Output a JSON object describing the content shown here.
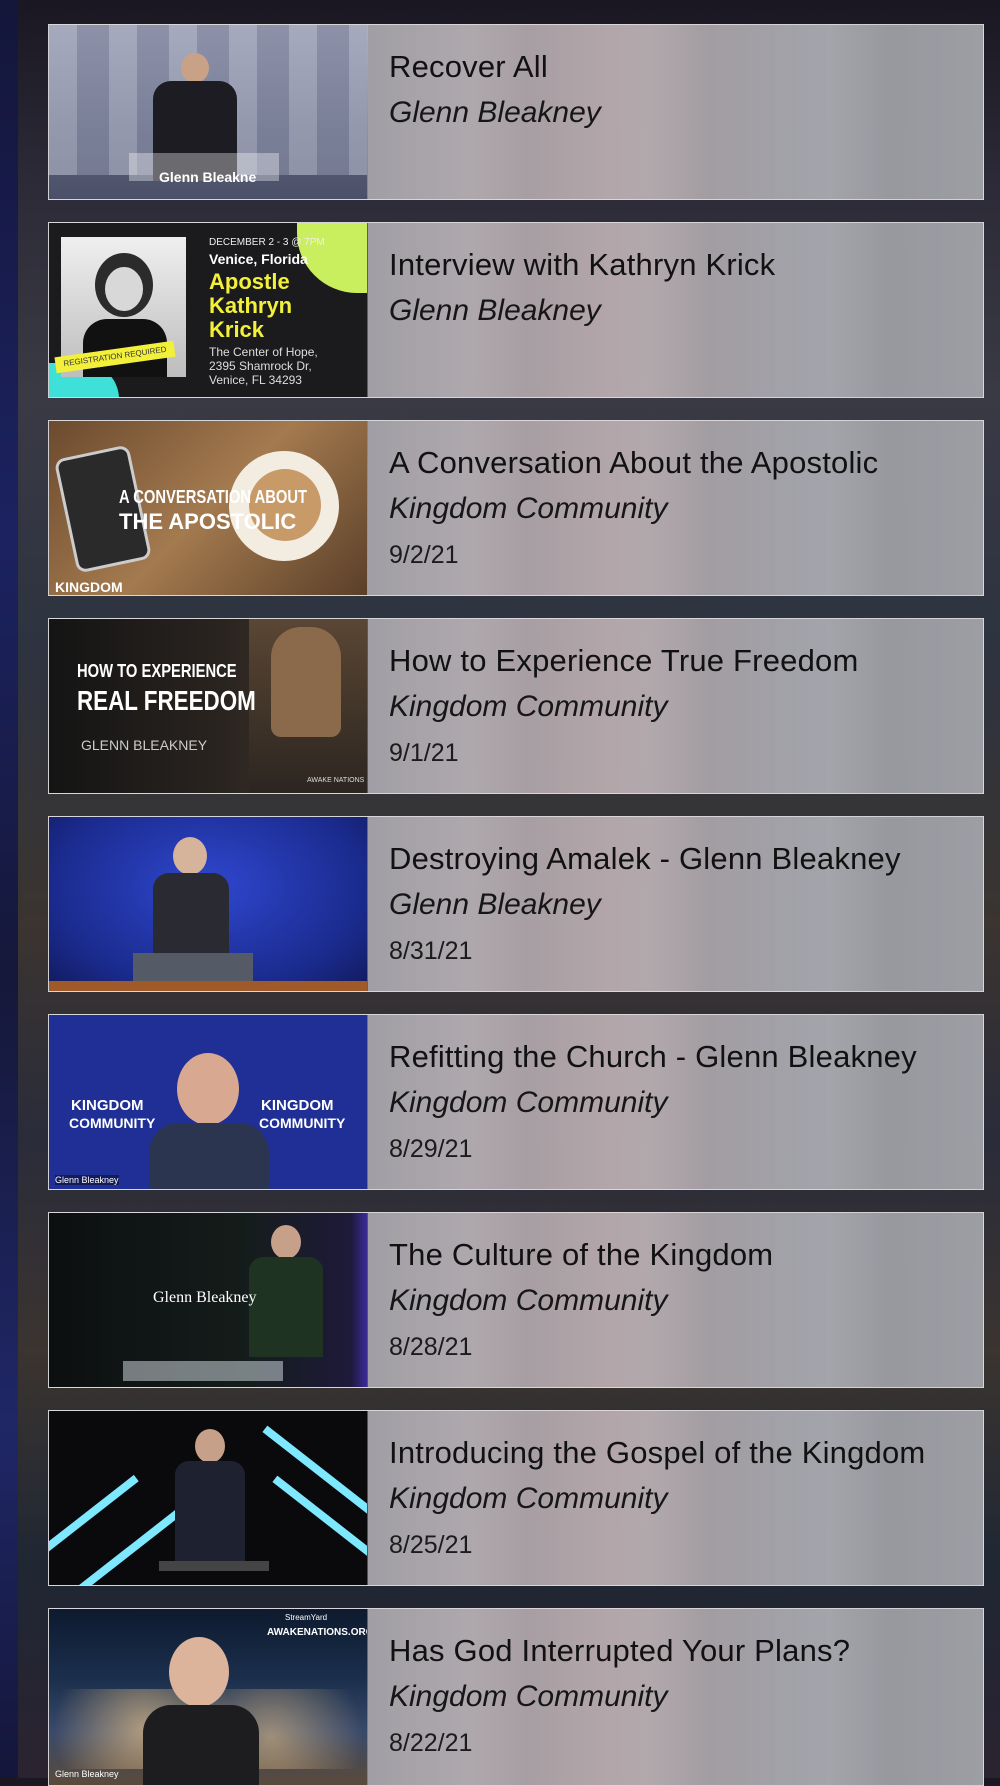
{
  "videos": [
    {
      "title": "Recover All",
      "author": "Glenn Bleakney",
      "date": "",
      "thumb_caption": "Glenn Bleakne"
    },
    {
      "title": "Interview with Kathryn Krick",
      "author": "Glenn Bleakney",
      "date": "",
      "thumb": {
        "date_line": "DECEMBER 2 - 3 @ 7PM",
        "location": "Venice, Florida",
        "name": "Apostle Kathryn Krick",
        "name_l1": "Apostle",
        "name_l2": "Kathryn",
        "name_l3": "Krick",
        "addr1": "The Center of Hope,",
        "addr2": "2395 Shamrock Dr,",
        "addr3": "Venice, FL 34293",
        "badge": "REGISTRATION REQUIRED"
      }
    },
    {
      "title": "A Conversation About the Apostolic",
      "author": "Kingdom Community",
      "date": "9/2/21",
      "thumb": {
        "line1": "A CONVERSATION ABOUT",
        "line2": "THE APOSTOLIC",
        "brand": "KINGDOM"
      }
    },
    {
      "title": "How to Experience True Freedom",
      "author": "Kingdom Community",
      "date": "9/1/21",
      "thumb": {
        "line1": "HOW TO EXPERIENCE",
        "line2": "REAL FREEDOM",
        "line3": "GLENN BLEAKNEY",
        "brand": "AWAKE NATIONS"
      }
    },
    {
      "title": "Destroying Amalek - Glenn Bleakney",
      "author": "Glenn Bleakney",
      "date": "8/31/21"
    },
    {
      "title": "Refitting the Church - Glenn Bleakney",
      "author": "Kingdom Community",
      "date": "8/29/21",
      "thumb": {
        "brand1": "KINGDOM",
        "brand2": "COMMUNITY",
        "caption": "Glenn Bleakney"
      }
    },
    {
      "title": "The Culture of the Kingdom",
      "author": "Kingdom Community",
      "date": "8/28/21",
      "thumb": {
        "caption": "Glenn Bleakney"
      }
    },
    {
      "title": "Introducing the Gospel of the Kingdom",
      "author": "Kingdom Community",
      "date": "8/25/21"
    },
    {
      "title": "Has God Interrupted Your Plans?",
      "author": "Kingdom Community",
      "date": "8/22/21",
      "thumb": {
        "top1": "StreamYard",
        "top2": "AWAKENATIONS.ORG",
        "caption": "Glenn Bleakney"
      }
    }
  ],
  "colors": {
    "card_bg": "#a9a7ad",
    "kathryn_yellow": "#f2f03a",
    "kingdom_blue": "#1f2f96",
    "stage_blue": "#2234a8"
  }
}
